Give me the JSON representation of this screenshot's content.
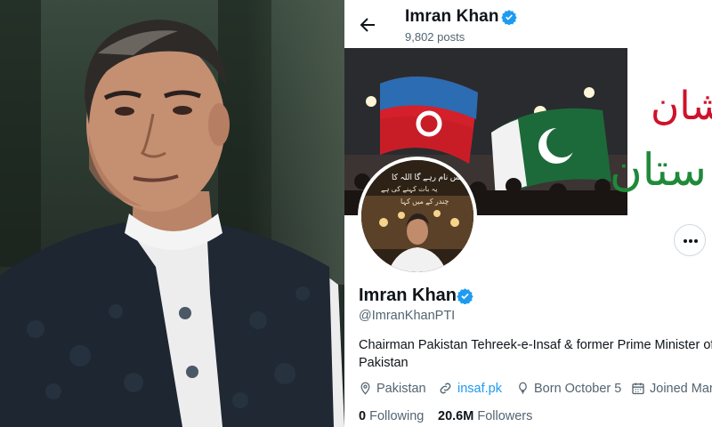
{
  "photo": {
    "subject": "man-in-dark-waistcoat-portrait"
  },
  "profile": {
    "header": {
      "name": "Imran Khan",
      "posts": "9,802 posts",
      "back_icon": "arrow-left-icon",
      "verified_icon": "verified-badge-icon"
    },
    "banner": {
      "urdu_line_1": "شان",
      "urdu_line_2": "ستان"
    },
    "avatar": {
      "caption_1": "بس نام رہے گا اللہ کا",
      "caption_2": "یہ بات کہنے کی ہے",
      "caption_3": "چندر کے میں کہا"
    },
    "name": "Imran Khan",
    "handle": "@ImranKhanPTI",
    "bio": "Chairman Pakistan Tehreek-e-Insaf & former Prime Minister of Pakistan",
    "meta": {
      "location": "Pakistan",
      "website": "insaf.pk",
      "birthday": "Born October 5",
      "joined": "Joined Mar"
    },
    "following": {
      "count": "0",
      "label": "Following"
    },
    "followers": {
      "count": "20.6M",
      "label": "Followers"
    },
    "colors": {
      "accent": "#1d9bf0",
      "secondary_text": "#536471",
      "primary_text": "#0f1419"
    }
  }
}
